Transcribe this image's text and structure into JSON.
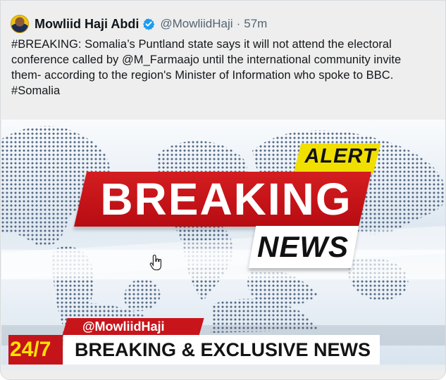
{
  "tweet": {
    "display_name": "Mowliid Haji Abdi",
    "handle": "@MowliidHaji",
    "separator": "·",
    "time": "57m",
    "text": "#BREAKING: Somalia’s Puntland state says it will not attend the electoral conference called by @M_Farmaajo  until the international community invite them- according to the region's Minister of Information who spoke to BBC. #Somalia",
    "verified_icon": "verified-badge-icon",
    "avatar_icon": "profile-photo"
  },
  "media": {
    "alert": "ALERT",
    "breaking": "BREAKING",
    "news": "NEWS",
    "handle_tag": "@MowliidHaji",
    "twenty_four_seven": "24/7",
    "ticker": "BREAKING & EXCLUSIVE NEWS",
    "colors": {
      "red": "#c4141a",
      "yellow": "#f1df00",
      "white": "#ffffff",
      "map": "#566b86"
    },
    "icons": [
      "world-map",
      "hand-cursor-icon"
    ]
  }
}
